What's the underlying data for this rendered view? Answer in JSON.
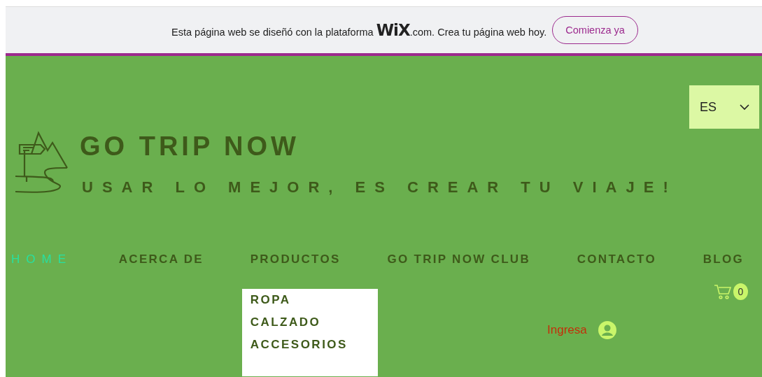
{
  "banner": {
    "text": "Esta página web se diseñó con la plataforma **WiX**.com. Crea tu página web hoy.",
    "button": "Comienza ya"
  },
  "language": {
    "value": "ES"
  },
  "site": {
    "title": "GO TRIP NOW",
    "tagline": "USAR LO MEJOR, ES CREAR TU VIAJE!"
  },
  "nav": [
    {
      "label": "HOME",
      "selected": true
    },
    {
      "label": "ACERCA DE",
      "selected": false
    },
    {
      "label": "PRODUCTOS",
      "selected": false,
      "children": [
        {
          "label": "ROPA"
        },
        {
          "label": "CALZADO"
        },
        {
          "label": "ACCESORIOS"
        }
      ]
    },
    {
      "label": "GO TRIP NOW CLUB",
      "selected": false
    },
    {
      "label": "CONTACTO",
      "selected": false
    },
    {
      "label": "BLOG",
      "selected": false
    }
  ],
  "cart": {
    "count": "0"
  },
  "login": {
    "label": "Ingresa"
  }
}
